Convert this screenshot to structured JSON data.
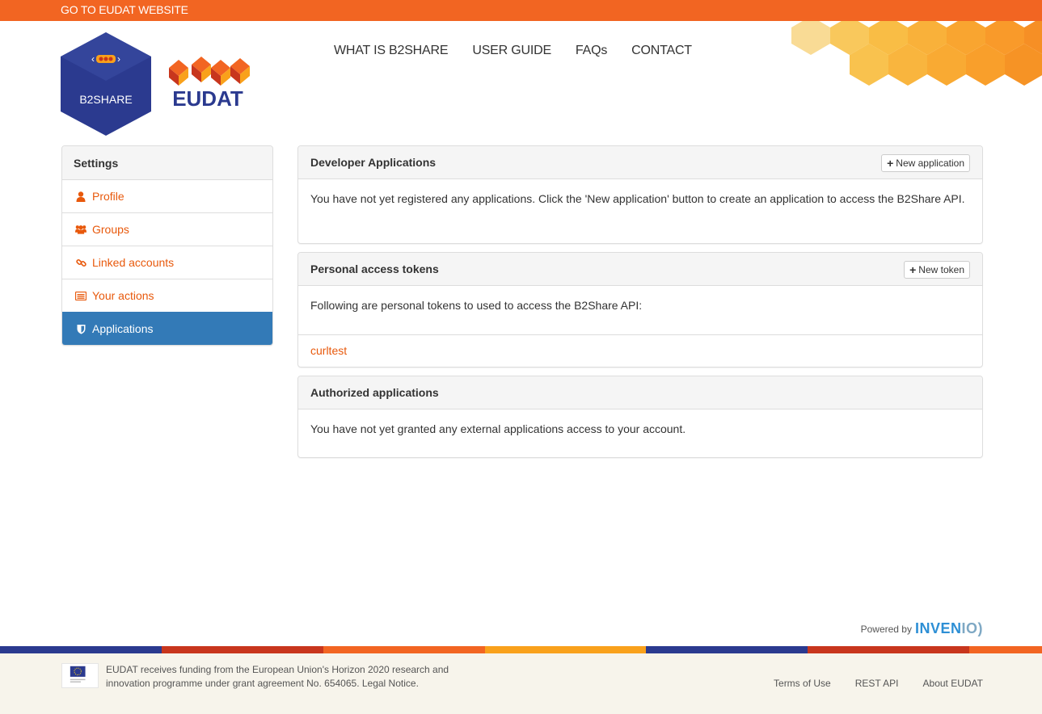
{
  "topbar": {
    "link_label": "GO TO EUDAT WEBSITE"
  },
  "logos": {
    "b2share": "B2SHARE",
    "eudat": "EUDAT"
  },
  "nav": {
    "items": [
      "WHAT IS B2SHARE",
      "USER GUIDE",
      "FAQs",
      "CONTACT"
    ]
  },
  "sidebar": {
    "title": "Settings",
    "items": [
      {
        "label": "Profile",
        "icon": "user-icon"
      },
      {
        "label": "Groups",
        "icon": "users-icon"
      },
      {
        "label": "Linked accounts",
        "icon": "link-icon"
      },
      {
        "label": "Your actions",
        "icon": "list-icon"
      },
      {
        "label": "Applications",
        "icon": "shield-icon",
        "active": true
      }
    ]
  },
  "developer_apps": {
    "title": "Developer Applications",
    "button": "New application",
    "text": "You have not yet registered any applications. Click the 'New application' button to create an application to access the B2Share API."
  },
  "tokens": {
    "title": "Personal access tokens",
    "button": "New token",
    "text": "Following are personal tokens to used to access the B2Share API:",
    "items": [
      "curltest"
    ]
  },
  "authorized": {
    "title": "Authorized applications",
    "text": "You have not yet granted any external applications access to your account."
  },
  "powered": {
    "prefix": "Powered by",
    "brand_a": "INVEN",
    "brand_b": "IO)"
  },
  "footer": {
    "funding": "EUDAT receives funding from the European Union's Horizon 2020 research and innovation programme under grant agreement No. 654065. Legal Notice.",
    "links": [
      "Terms of Use",
      "REST API",
      "About EUDAT"
    ]
  },
  "colors": {
    "accent": "#f26522",
    "link": "#e8590c",
    "active": "#337ab7",
    "stripe": [
      "#2b3a8f",
      "#c8361d",
      "#f26522",
      "#f9a11b",
      "#2b3a8f",
      "#c8361d",
      "#f26522"
    ]
  }
}
